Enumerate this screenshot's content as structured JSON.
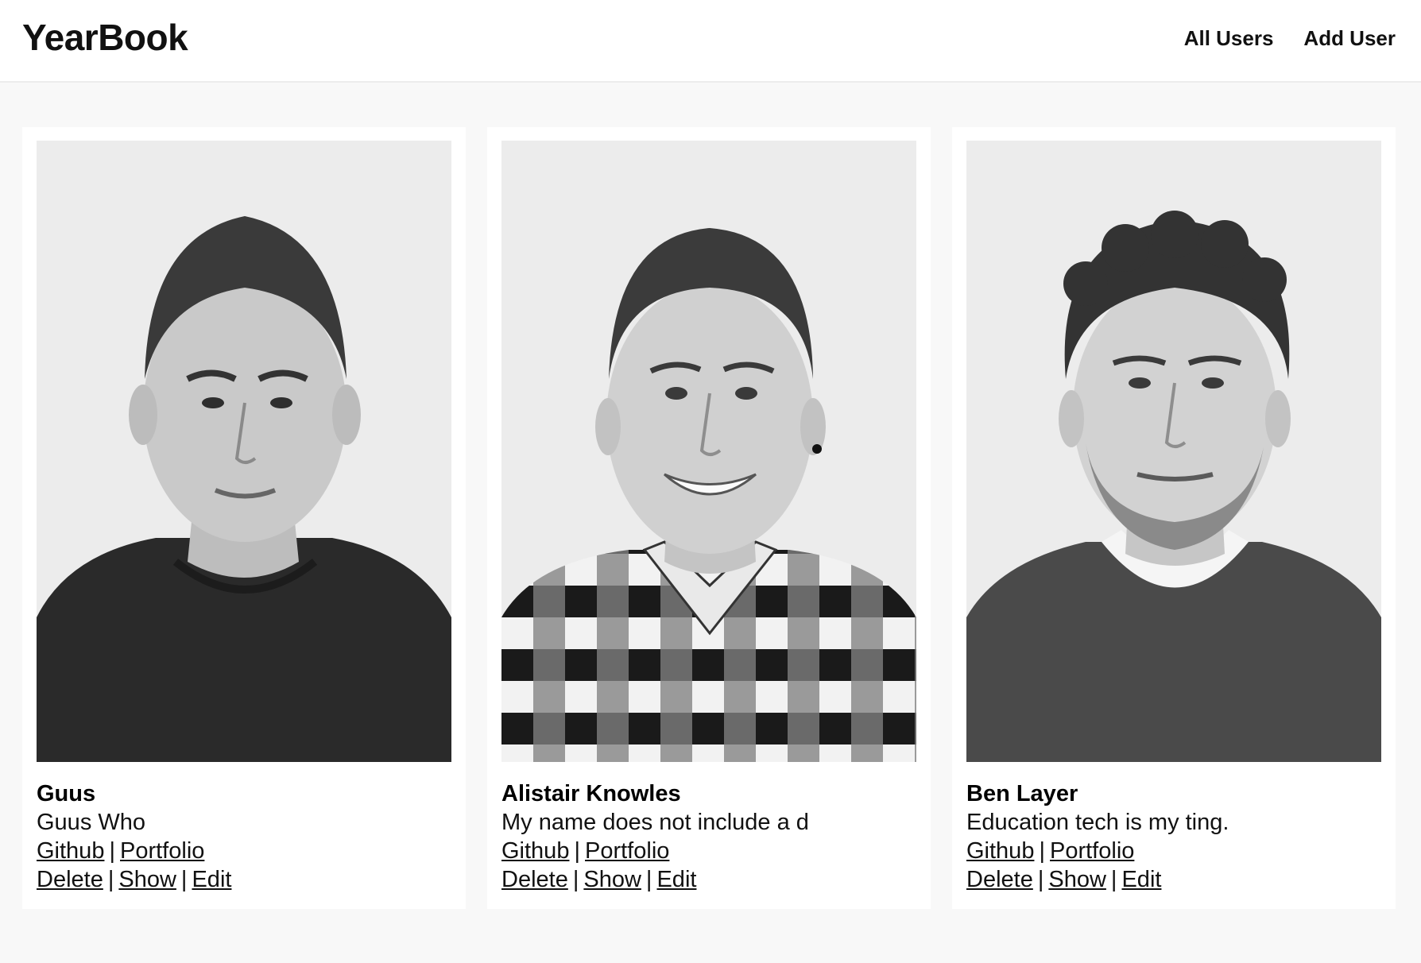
{
  "header": {
    "brand": "YearBook",
    "nav": [
      {
        "label": "All Users"
      },
      {
        "label": "Add User"
      }
    ]
  },
  "users": [
    {
      "name": "Guus",
      "bio": "Guus Who",
      "links": {
        "github": "Github",
        "portfolio": "Portfolio"
      },
      "actions": {
        "delete": "Delete",
        "show": "Show",
        "edit": "Edit"
      }
    },
    {
      "name": "Alistair Knowles",
      "bio": "My name does not include a d",
      "links": {
        "github": "Github",
        "portfolio": "Portfolio"
      },
      "actions": {
        "delete": "Delete",
        "show": "Show",
        "edit": "Edit"
      }
    },
    {
      "name": "Ben Layer",
      "bio": "Education tech is my ting.",
      "links": {
        "github": "Github",
        "portfolio": "Portfolio"
      },
      "actions": {
        "delete": "Delete",
        "show": "Show",
        "edit": "Edit"
      }
    }
  ],
  "separator": "|"
}
